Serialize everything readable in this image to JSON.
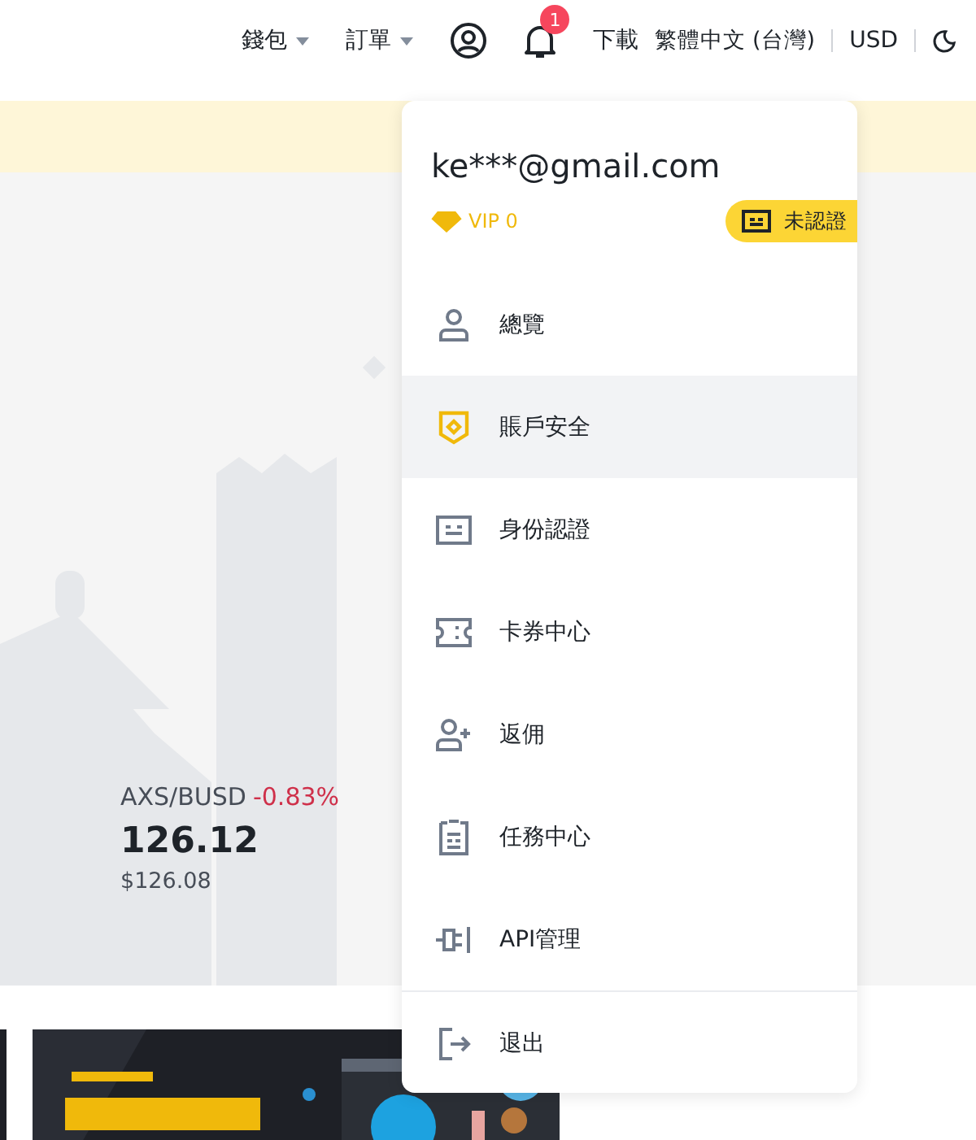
{
  "header": {
    "nav": [
      {
        "label": "錢包",
        "kind": "dropdown"
      },
      {
        "label": "訂單",
        "kind": "dropdown"
      }
    ],
    "notification_count": "1",
    "links": [
      {
        "label": "下載"
      },
      {
        "label": "繁體中文 (台灣)"
      },
      {
        "label": "USD"
      }
    ]
  },
  "ticker": {
    "pair": "AXS/BUSD",
    "change": "-0.83%",
    "price": "126.12",
    "usd_price": "$126.08"
  },
  "account_menu": {
    "email": "ke***@gmail.com",
    "vip": "VIP 0",
    "verify_badge": "未認證",
    "items": [
      {
        "label": "總覽",
        "selected": false
      },
      {
        "label": "賬戶安全",
        "selected": true
      },
      {
        "label": "身份認證",
        "selected": false
      },
      {
        "label": "卡券中心",
        "selected": false
      },
      {
        "label": "返佣",
        "selected": false
      },
      {
        "label": "任務中心",
        "selected": false
      },
      {
        "label": "API管理",
        "selected": false
      }
    ],
    "logout": {
      "label": "退出"
    }
  }
}
